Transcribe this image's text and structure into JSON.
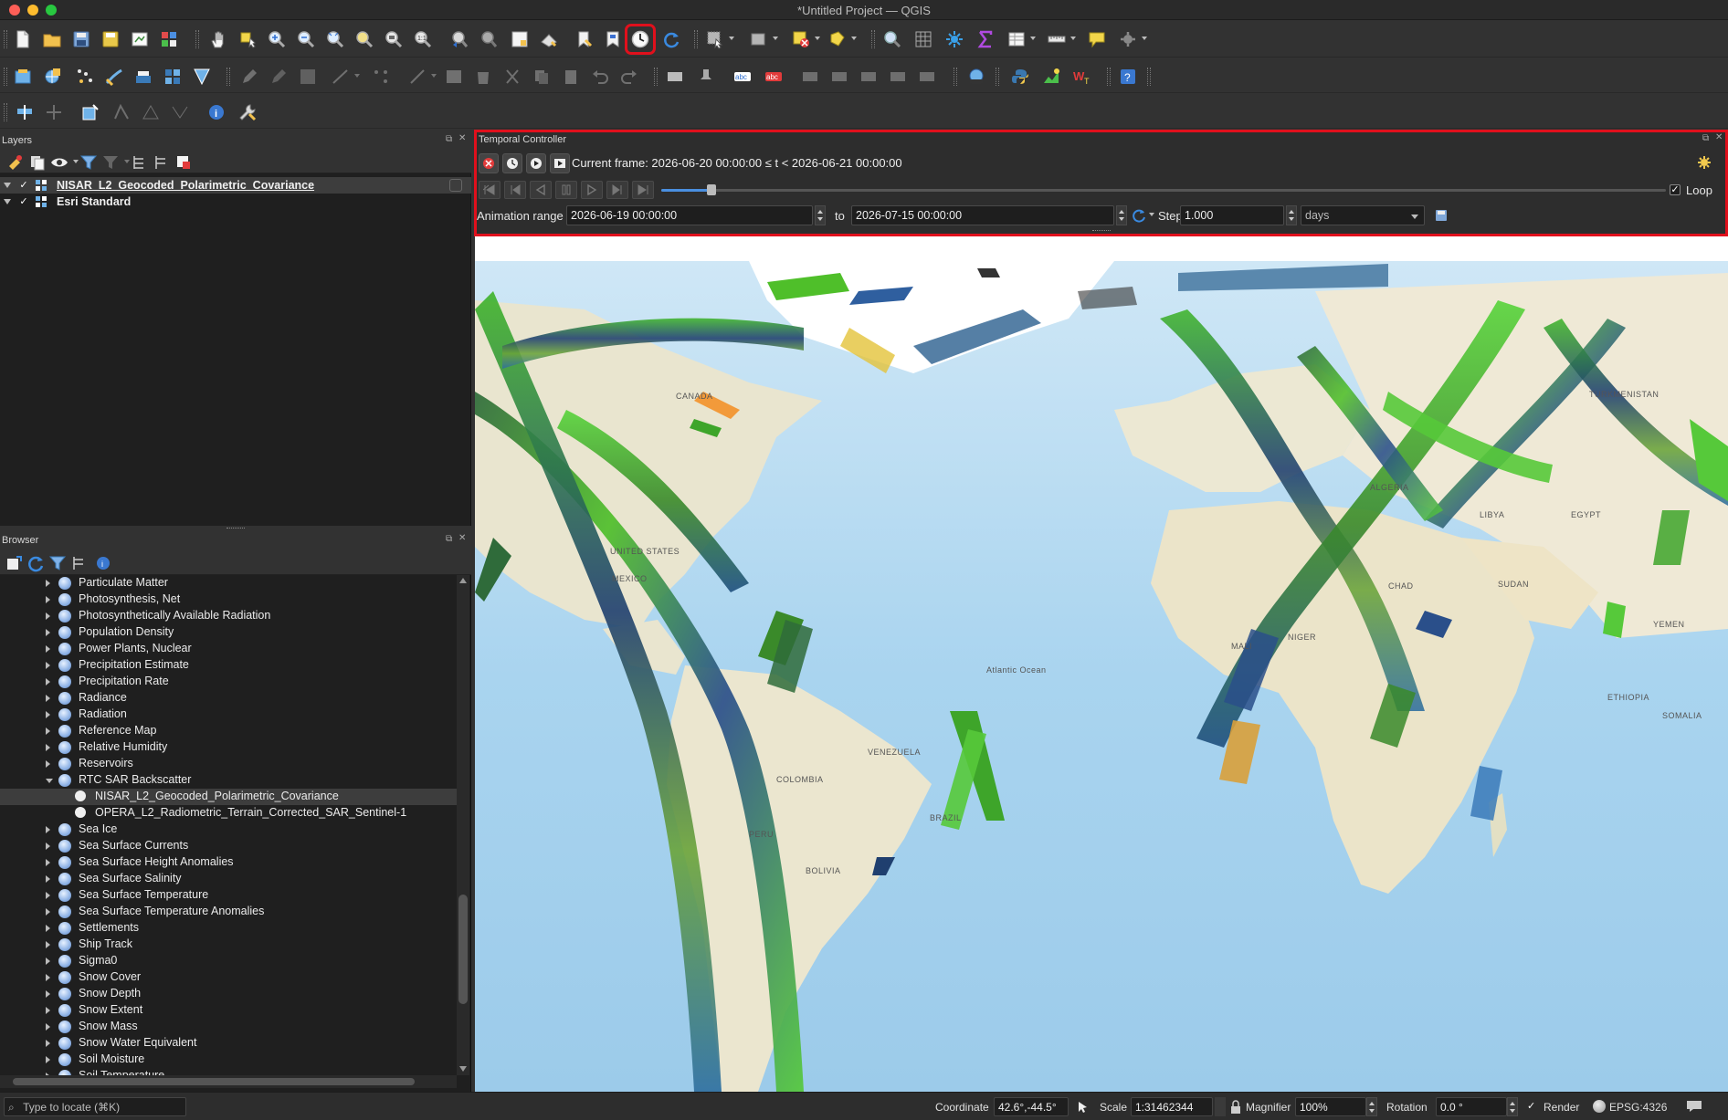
{
  "window": {
    "title": "*Untitled Project — QGIS"
  },
  "toolbar_icons": [
    "new-project",
    "open-project",
    "save-project",
    "save-as",
    "print-layout",
    "layout-manager",
    "pan",
    "pan-to-selection",
    "zoom-in",
    "zoom-out",
    "zoom-full",
    "zoom-to-selection",
    "zoom-to-layer",
    "zoom-native",
    "zoom-last",
    "zoom-next",
    "new-map-view",
    "new-3d-view",
    "new-bookmark",
    "show-bookmarks",
    "temporal-controller",
    "refresh"
  ],
  "layers_panel": {
    "title": "Layers",
    "layers": [
      {
        "name": "NISAR_L2_Geocoded_Polarimetric_Covariance",
        "checked": true,
        "selected": true
      },
      {
        "name": "Esri Standard",
        "checked": true,
        "selected": false
      }
    ]
  },
  "browser_panel": {
    "title": "Browser",
    "items": [
      {
        "label": "Particulate Matter",
        "level": 1,
        "expanded": false
      },
      {
        "label": "Photosynthesis, Net",
        "level": 1,
        "expanded": false
      },
      {
        "label": "Photosynthetically Available Radiation",
        "level": 1,
        "expanded": false
      },
      {
        "label": "Population Density",
        "level": 1,
        "expanded": false
      },
      {
        "label": "Power Plants, Nuclear",
        "level": 1,
        "expanded": false
      },
      {
        "label": "Precipitation Estimate",
        "level": 1,
        "expanded": false
      },
      {
        "label": "Precipitation Rate",
        "level": 1,
        "expanded": false
      },
      {
        "label": "Radiance",
        "level": 1,
        "expanded": false
      },
      {
        "label": "Radiation",
        "level": 1,
        "expanded": false
      },
      {
        "label": "Reference Map",
        "level": 1,
        "expanded": false
      },
      {
        "label": "Relative Humidity",
        "level": 1,
        "expanded": false
      },
      {
        "label": "Reservoirs",
        "level": 1,
        "expanded": false
      },
      {
        "label": "RTC SAR Backscatter",
        "level": 1,
        "expanded": true
      },
      {
        "label": "NISAR_L2_Geocoded_Polarimetric_Covariance",
        "level": 2,
        "selected": true
      },
      {
        "label": "OPERA_L2_Radiometric_Terrain_Corrected_SAR_Sentinel-1",
        "level": 2
      },
      {
        "label": "Sea Ice",
        "level": 1,
        "expanded": false
      },
      {
        "label": "Sea Surface Currents",
        "level": 1,
        "expanded": false
      },
      {
        "label": "Sea Surface Height Anomalies",
        "level": 1,
        "expanded": false
      },
      {
        "label": "Sea Surface Salinity",
        "level": 1,
        "expanded": false
      },
      {
        "label": "Sea Surface Temperature",
        "level": 1,
        "expanded": false
      },
      {
        "label": "Sea Surface Temperature Anomalies",
        "level": 1,
        "expanded": false
      },
      {
        "label": "Settlements",
        "level": 1,
        "expanded": false
      },
      {
        "label": "Ship Track",
        "level": 1,
        "expanded": false
      },
      {
        "label": "Sigma0",
        "level": 1,
        "expanded": false
      },
      {
        "label": "Snow Cover",
        "level": 1,
        "expanded": false
      },
      {
        "label": "Snow Depth",
        "level": 1,
        "expanded": false
      },
      {
        "label": "Snow Extent",
        "level": 1,
        "expanded": false
      },
      {
        "label": "Snow Mass",
        "level": 1,
        "expanded": false
      },
      {
        "label": "Snow Water Equivalent",
        "level": 1,
        "expanded": false
      },
      {
        "label": "Soil Moisture",
        "level": 1,
        "expanded": false
      },
      {
        "label": "Soil Temperature",
        "level": 1,
        "expanded": false
      }
    ]
  },
  "temporal": {
    "title": "Temporal Controller",
    "current_frame": "Current frame: 2026-06-20 00:00:00 ≤ t < 2026-06-21 00:00:00",
    "loop_label": "Loop",
    "loop_checked": true,
    "range_label": "Animation range",
    "range_start": "2026-06-19 00:00:00",
    "to_label": "to",
    "range_end": "2026-07-15 00:00:00",
    "step_label": "Step",
    "step_value": "1.000",
    "step_unit": "days",
    "slider_position": 0.02
  },
  "map": {
    "labels": [
      {
        "text": "UNITED STATES"
      },
      {
        "text": "Atlantic Ocean"
      },
      {
        "text": "BRAZIL"
      },
      {
        "text": "MALI"
      },
      {
        "text": "NIGER"
      },
      {
        "text": "CHAD"
      },
      {
        "text": "SUDAN"
      },
      {
        "text": "ALGERIA"
      },
      {
        "text": "LIBYA"
      },
      {
        "text": "EGYPT"
      },
      {
        "text": "ETHIOPIA"
      },
      {
        "text": "PERU"
      },
      {
        "text": "BOLIVIA"
      },
      {
        "text": "COLOMBIA"
      },
      {
        "text": "VENEZUELA"
      },
      {
        "text": "MEXICO"
      },
      {
        "text": "CANADA"
      },
      {
        "text": "TURKMENISTAN"
      },
      {
        "text": "YEMEN"
      },
      {
        "text": "SOMALIA"
      }
    ]
  },
  "statusbar": {
    "locate_placeholder": "Type to locate (⌘K)",
    "coordinate_label": "Coordinate",
    "coordinate_value": "42.6°,-44.5°",
    "scale_label": "Scale",
    "scale_value": "1:31462344",
    "magnifier_label": "Magnifier",
    "magnifier_value": "100%",
    "rotation_label": "Rotation",
    "rotation_value": "0.0 °",
    "render_label": "Render",
    "render_checked": true,
    "crs": "EPSG:4326"
  },
  "colors": {
    "highlight_red": "#e0101c",
    "panel_bg": "#1f1f1f",
    "toolbar_bg": "#323232",
    "ocean": "#a9d4ef",
    "land": "#efe9d6",
    "swath_green": "#4fbf2a"
  }
}
